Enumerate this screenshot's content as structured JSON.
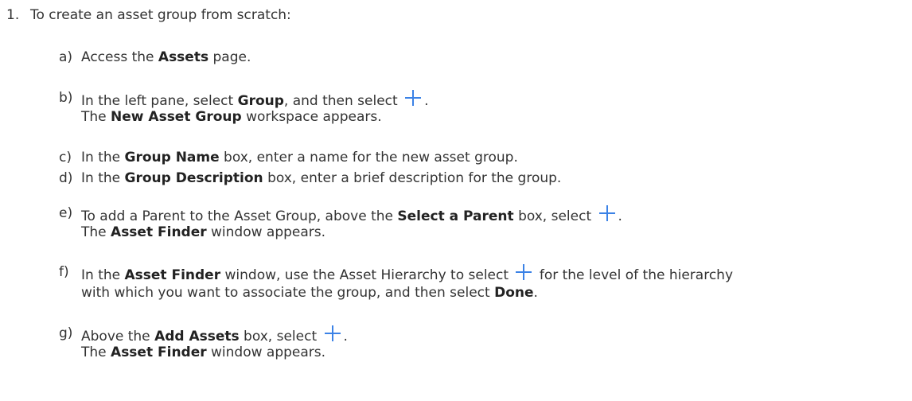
{
  "step": {
    "number": "1.",
    "text": "To create an asset group from scratch:"
  },
  "substeps": {
    "a": {
      "label": "a)",
      "t1": "Access the ",
      "b1": "Assets",
      "t2": " page."
    },
    "b": {
      "label": "b)",
      "t1": "In the left pane, select ",
      "b1": "Group",
      "t2": ", and then select ",
      "t3": ".",
      "r1": "The ",
      "rb1": "New Asset Group",
      "r2": " workspace appears."
    },
    "c": {
      "label": "c)",
      "t1": "In the ",
      "b1": "Group Name",
      "t2": " box, enter a name for the new asset group."
    },
    "d": {
      "label": "d)",
      "t1": "In the ",
      "b1": "Group Description",
      "t2": " box, enter a brief description for the group."
    },
    "e": {
      "label": "e)",
      "t1": "To add a Parent to the Asset Group, above the ",
      "b1": "Select a Parent",
      "t2": " box, select ",
      "t3": ".",
      "r1": "The ",
      "rb1": "Asset Finder",
      "r2": " window appears."
    },
    "f": {
      "label": "f)",
      "t1": "In the ",
      "b1": "Asset Finder",
      "t2": " window, use the Asset Hierarchy to select ",
      "t3": " for the level of the hierarchy",
      "c1": "with which you want to associate the group, and then select ",
      "cb1": "Done",
      "c2": "."
    },
    "g": {
      "label": "g)",
      "t1": "Above the ",
      "b1": "Add Assets",
      "t2": " box, select ",
      "t3": ".",
      "r1": "The ",
      "rb1": "Asset Finder",
      "r2": " window appears."
    }
  },
  "icons": {
    "add": "plus-icon",
    "accent": "#3b82e6"
  }
}
